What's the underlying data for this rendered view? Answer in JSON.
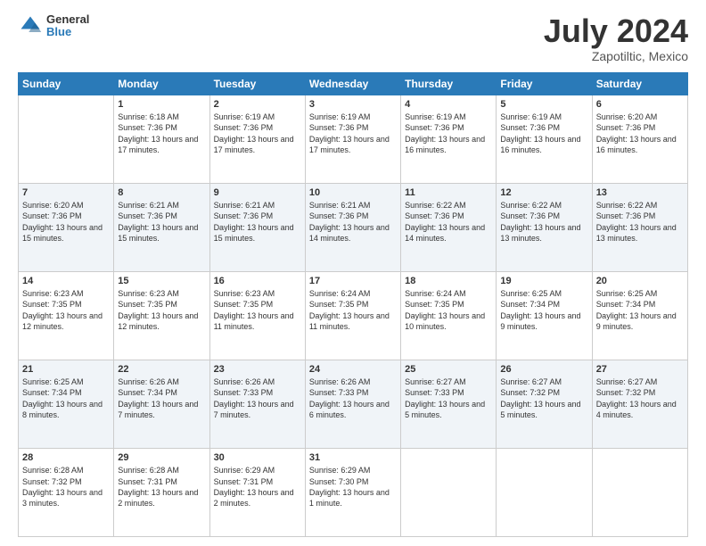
{
  "header": {
    "logo_general": "General",
    "logo_blue": "Blue",
    "title": "July 2024",
    "location": "Zapotiltic, Mexico"
  },
  "days_of_week": [
    "Sunday",
    "Monday",
    "Tuesday",
    "Wednesday",
    "Thursday",
    "Friday",
    "Saturday"
  ],
  "weeks": [
    [
      {
        "day": "",
        "sunrise": "",
        "sunset": "",
        "daylight": "",
        "empty": true
      },
      {
        "day": "1",
        "sunrise": "Sunrise: 6:18 AM",
        "sunset": "Sunset: 7:36 PM",
        "daylight": "Daylight: 13 hours and 17 minutes."
      },
      {
        "day": "2",
        "sunrise": "Sunrise: 6:19 AM",
        "sunset": "Sunset: 7:36 PM",
        "daylight": "Daylight: 13 hours and 17 minutes."
      },
      {
        "day": "3",
        "sunrise": "Sunrise: 6:19 AM",
        "sunset": "Sunset: 7:36 PM",
        "daylight": "Daylight: 13 hours and 17 minutes."
      },
      {
        "day": "4",
        "sunrise": "Sunrise: 6:19 AM",
        "sunset": "Sunset: 7:36 PM",
        "daylight": "Daylight: 13 hours and 16 minutes."
      },
      {
        "day": "5",
        "sunrise": "Sunrise: 6:19 AM",
        "sunset": "Sunset: 7:36 PM",
        "daylight": "Daylight: 13 hours and 16 minutes."
      },
      {
        "day": "6",
        "sunrise": "Sunrise: 6:20 AM",
        "sunset": "Sunset: 7:36 PM",
        "daylight": "Daylight: 13 hours and 16 minutes."
      }
    ],
    [
      {
        "day": "7",
        "sunrise": "Sunrise: 6:20 AM",
        "sunset": "Sunset: 7:36 PM",
        "daylight": "Daylight: 13 hours and 15 minutes."
      },
      {
        "day": "8",
        "sunrise": "Sunrise: 6:21 AM",
        "sunset": "Sunset: 7:36 PM",
        "daylight": "Daylight: 13 hours and 15 minutes."
      },
      {
        "day": "9",
        "sunrise": "Sunrise: 6:21 AM",
        "sunset": "Sunset: 7:36 PM",
        "daylight": "Daylight: 13 hours and 15 minutes."
      },
      {
        "day": "10",
        "sunrise": "Sunrise: 6:21 AM",
        "sunset": "Sunset: 7:36 PM",
        "daylight": "Daylight: 13 hours and 14 minutes."
      },
      {
        "day": "11",
        "sunrise": "Sunrise: 6:22 AM",
        "sunset": "Sunset: 7:36 PM",
        "daylight": "Daylight: 13 hours and 14 minutes."
      },
      {
        "day": "12",
        "sunrise": "Sunrise: 6:22 AM",
        "sunset": "Sunset: 7:36 PM",
        "daylight": "Daylight: 13 hours and 13 minutes."
      },
      {
        "day": "13",
        "sunrise": "Sunrise: 6:22 AM",
        "sunset": "Sunset: 7:36 PM",
        "daylight": "Daylight: 13 hours and 13 minutes."
      }
    ],
    [
      {
        "day": "14",
        "sunrise": "Sunrise: 6:23 AM",
        "sunset": "Sunset: 7:35 PM",
        "daylight": "Daylight: 13 hours and 12 minutes."
      },
      {
        "day": "15",
        "sunrise": "Sunrise: 6:23 AM",
        "sunset": "Sunset: 7:35 PM",
        "daylight": "Daylight: 13 hours and 12 minutes."
      },
      {
        "day": "16",
        "sunrise": "Sunrise: 6:23 AM",
        "sunset": "Sunset: 7:35 PM",
        "daylight": "Daylight: 13 hours and 11 minutes."
      },
      {
        "day": "17",
        "sunrise": "Sunrise: 6:24 AM",
        "sunset": "Sunset: 7:35 PM",
        "daylight": "Daylight: 13 hours and 11 minutes."
      },
      {
        "day": "18",
        "sunrise": "Sunrise: 6:24 AM",
        "sunset": "Sunset: 7:35 PM",
        "daylight": "Daylight: 13 hours and 10 minutes."
      },
      {
        "day": "19",
        "sunrise": "Sunrise: 6:25 AM",
        "sunset": "Sunset: 7:34 PM",
        "daylight": "Daylight: 13 hours and 9 minutes."
      },
      {
        "day": "20",
        "sunrise": "Sunrise: 6:25 AM",
        "sunset": "Sunset: 7:34 PM",
        "daylight": "Daylight: 13 hours and 9 minutes."
      }
    ],
    [
      {
        "day": "21",
        "sunrise": "Sunrise: 6:25 AM",
        "sunset": "Sunset: 7:34 PM",
        "daylight": "Daylight: 13 hours and 8 minutes."
      },
      {
        "day": "22",
        "sunrise": "Sunrise: 6:26 AM",
        "sunset": "Sunset: 7:34 PM",
        "daylight": "Daylight: 13 hours and 7 minutes."
      },
      {
        "day": "23",
        "sunrise": "Sunrise: 6:26 AM",
        "sunset": "Sunset: 7:33 PM",
        "daylight": "Daylight: 13 hours and 7 minutes."
      },
      {
        "day": "24",
        "sunrise": "Sunrise: 6:26 AM",
        "sunset": "Sunset: 7:33 PM",
        "daylight": "Daylight: 13 hours and 6 minutes."
      },
      {
        "day": "25",
        "sunrise": "Sunrise: 6:27 AM",
        "sunset": "Sunset: 7:33 PM",
        "daylight": "Daylight: 13 hours and 5 minutes."
      },
      {
        "day": "26",
        "sunrise": "Sunrise: 6:27 AM",
        "sunset": "Sunset: 7:32 PM",
        "daylight": "Daylight: 13 hours and 5 minutes."
      },
      {
        "day": "27",
        "sunrise": "Sunrise: 6:27 AM",
        "sunset": "Sunset: 7:32 PM",
        "daylight": "Daylight: 13 hours and 4 minutes."
      }
    ],
    [
      {
        "day": "28",
        "sunrise": "Sunrise: 6:28 AM",
        "sunset": "Sunset: 7:32 PM",
        "daylight": "Daylight: 13 hours and 3 minutes."
      },
      {
        "day": "29",
        "sunrise": "Sunrise: 6:28 AM",
        "sunset": "Sunset: 7:31 PM",
        "daylight": "Daylight: 13 hours and 2 minutes."
      },
      {
        "day": "30",
        "sunrise": "Sunrise: 6:29 AM",
        "sunset": "Sunset: 7:31 PM",
        "daylight": "Daylight: 13 hours and 2 minutes."
      },
      {
        "day": "31",
        "sunrise": "Sunrise: 6:29 AM",
        "sunset": "Sunset: 7:30 PM",
        "daylight": "Daylight: 13 hours and 1 minute."
      },
      {
        "day": "",
        "sunrise": "",
        "sunset": "",
        "daylight": "",
        "empty": true
      },
      {
        "day": "",
        "sunrise": "",
        "sunset": "",
        "daylight": "",
        "empty": true
      },
      {
        "day": "",
        "sunrise": "",
        "sunset": "",
        "daylight": "",
        "empty": true
      }
    ]
  ]
}
